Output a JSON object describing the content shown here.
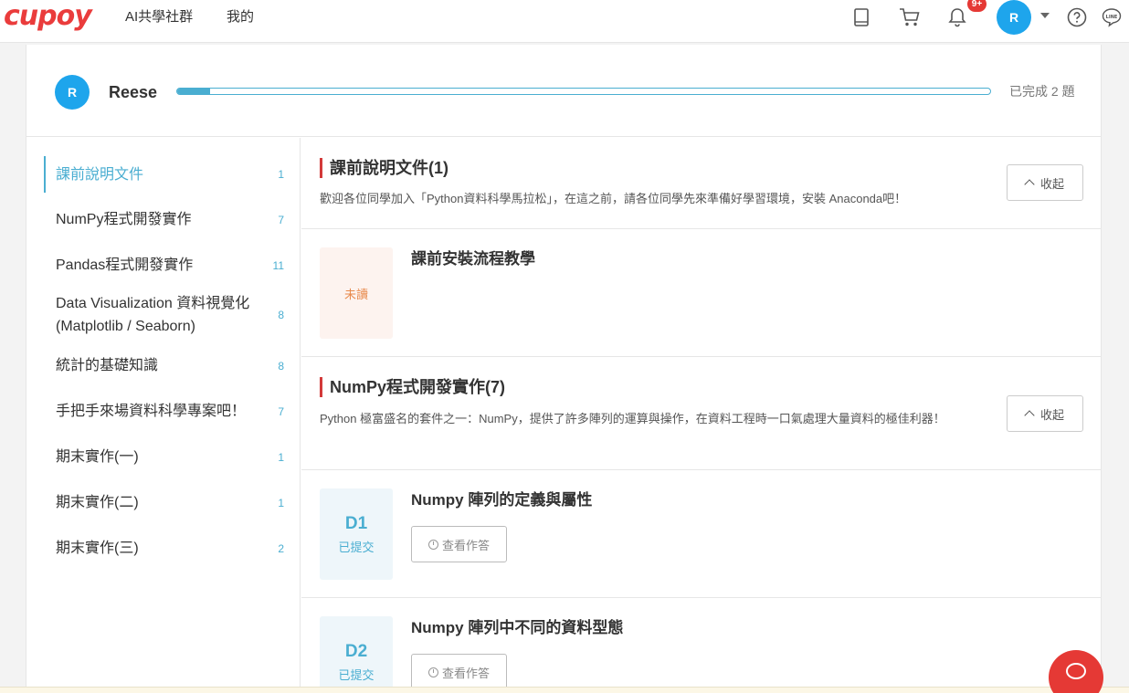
{
  "brand": {
    "logo": "cupoy",
    "logo_color": "#ea3c3c"
  },
  "nav": {
    "links": [
      "AI共學社群",
      "我的"
    ],
    "notification_badge": "9+",
    "avatar_initial": "R"
  },
  "progress": {
    "avatar_initial": "R",
    "user_name": "Reese",
    "fraction": 0.04,
    "label": "已完成 2 題"
  },
  "sidebar": {
    "items": [
      {
        "label": "課前說明文件",
        "count": "1",
        "active": true
      },
      {
        "label": "NumPy程式開發實作",
        "count": "7"
      },
      {
        "label": "Pandas程式開發實作",
        "count": "11"
      },
      {
        "label": "Data Visualization 資料視覺化 (Matplotlib / Seaborn)",
        "count": "8"
      },
      {
        "label": "統計的基礎知識",
        "count": "8"
      },
      {
        "label": "手把手來場資料科學專案吧！",
        "count": "7"
      },
      {
        "label": "期末實作(一)",
        "count": "1"
      },
      {
        "label": "期末實作(二)",
        "count": "1"
      },
      {
        "label": "期末實作(三)",
        "count": "2"
      }
    ]
  },
  "sections": [
    {
      "title": "課前說明文件(1)",
      "description": "歡迎各位同學加入「Python資料科學馬拉松」，在這之前，請各位同學先來準備好學習環境，安裝 Anaconda吧！",
      "collapse_label": "收起",
      "lessons": [
        {
          "status": "未讀",
          "title": "課前安裝流程教學"
        }
      ]
    },
    {
      "title": "NumPy程式開發實作(7)",
      "description": "Python 極富盛名的套件之一：NumPy，提供了許多陣列的運算與操作，在資料工程時一口氣處理大量資料的極佳利器！",
      "collapse_label": "收起",
      "lessons": [
        {
          "day": "D1",
          "status": "已提交",
          "title": "Numpy 陣列的定義與屬性",
          "button": "查看作答"
        },
        {
          "day": "D2",
          "status": "已提交",
          "title": "Numpy 陣列中不同的資料型態",
          "button": "查看作答"
        }
      ]
    }
  ],
  "colors": {
    "accent": "#4aaed1",
    "brand_red": "#e53935",
    "unread": "#e88a4c"
  }
}
